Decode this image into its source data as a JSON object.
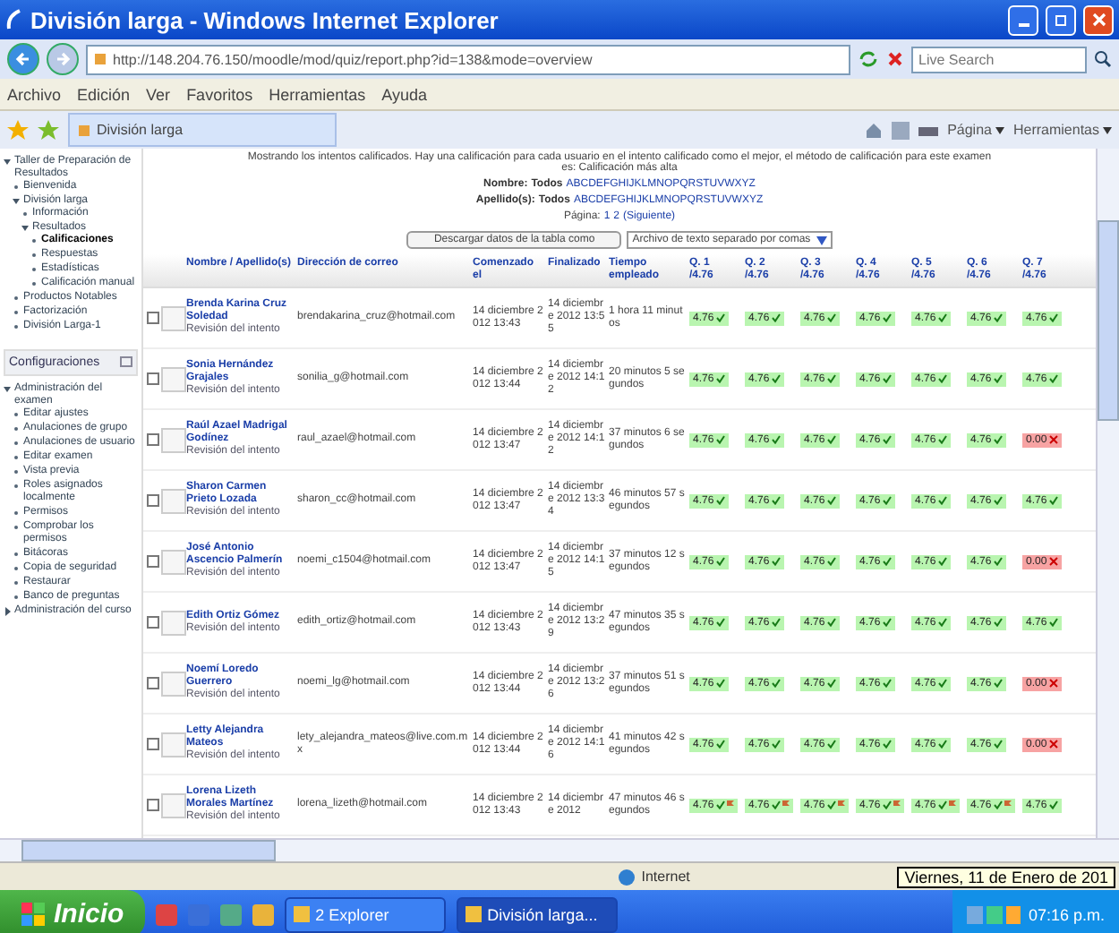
{
  "window": {
    "title": "División larga - Windows Internet Explorer"
  },
  "address": {
    "value": "http://148.204.76.150/moodle/mod/quiz/report.php?id=138&mode=overview"
  },
  "search": {
    "placeholder": "Live Search"
  },
  "menu": [
    "Archivo",
    "Edición",
    "Ver",
    "Favoritos",
    "Herramientas",
    "Ayuda"
  ],
  "tab": {
    "label": "División larga"
  },
  "command_bar": [
    "Página",
    "Herramientas"
  ],
  "sidebar": {
    "items": [
      {
        "label": "Taller de Preparación de Resultados",
        "expanded": true,
        "children": [
          {
            "label": "Bienvenida"
          },
          {
            "label": "División larga",
            "expanded": true,
            "children": [
              {
                "label": "Información"
              },
              {
                "label": "Resultados",
                "expanded": true,
                "children": [
                  {
                    "label": "Calificaciones",
                    "selected": true
                  },
                  {
                    "label": "Respuestas",
                    "selected": false
                  },
                  {
                    "label": "Estadísticas",
                    "selected": false
                  },
                  {
                    "label": "Calificación manual",
                    "selected": false
                  }
                ]
              }
            ]
          },
          {
            "label": "Productos Notables"
          },
          {
            "label": "Factorización"
          },
          {
            "label": "División Larga-1"
          }
        ]
      }
    ],
    "settings_title": "Configuraciones",
    "settings": [
      {
        "label": "Administración del examen",
        "expanded": true,
        "children": [
          {
            "label": "Editar ajustes"
          },
          {
            "label": "Anulaciones de grupo"
          },
          {
            "label": "Anulaciones de usuario"
          },
          {
            "label": "Editar examen"
          },
          {
            "label": "Vista previa"
          },
          {
            "label": "Roles asignados localmente"
          },
          {
            "label": "Permisos"
          },
          {
            "label": "Comprobar los permisos"
          },
          {
            "label": "Bitácoras"
          },
          {
            "label": "Copia de seguridad"
          },
          {
            "label": "Restaurar"
          },
          {
            "label": "Banco de preguntas"
          }
        ]
      },
      {
        "label": "Administración del curso",
        "expanded": false
      }
    ]
  },
  "intro": "Mostrando los intentos calificados. Hay una calificación para cada usuario en el intento calificado como el mejor, el método de calificación para este examen es: Calificación más alta",
  "filters": [
    {
      "label": "Nombre:",
      "all": "Todos",
      "letters": "ABCDEFGHIJKLMNOPQRSTUVWXYZ"
    },
    {
      "label": "Apellido(s):",
      "all": "Todos",
      "letters": "ABCDEFGHIJKLMNOPQRSTUVWXYZ"
    }
  ],
  "paging": {
    "label": "Página:",
    "pages": [
      "1",
      "2"
    ],
    "next": "(Siguiente)"
  },
  "download": {
    "button": "Descargar datos de la tabla como",
    "format": "Archivo de texto separado por comas"
  },
  "table": {
    "columns": [
      "Nombre / Apellido(s)",
      "Dirección de correo",
      "Comenzado el",
      "Finalizado",
      "Tiempo empleado"
    ],
    "questions": [
      {
        "label": "Q. 1",
        "max": "/4.76"
      },
      {
        "label": "Q. 2",
        "max": "/4.76"
      },
      {
        "label": "Q. 3",
        "max": "/4.76"
      },
      {
        "label": "Q. 4",
        "max": "/4.76"
      },
      {
        "label": "Q. 5",
        "max": "/4.76"
      },
      {
        "label": "Q. 6",
        "max": "/4.76"
      },
      {
        "label": "Q. 7",
        "max": "/4.76"
      }
    ],
    "rows": [
      {
        "checked": false,
        "name": "Brenda Karina Cruz Soledad",
        "review": "Revisión del intento",
        "email": "brendakarina_cruz@hotmail.com",
        "started": "14 diciembre 2012 13:43",
        "finished": "14 diciembre 2012 13:55",
        "time": "1 hora 11 minutos",
        "grades": [
          {
            "value": "4.76",
            "correct": true,
            "flagged": false
          },
          {
            "value": "4.76",
            "correct": true,
            "flagged": false
          },
          {
            "value": "4.76",
            "correct": true,
            "flagged": false
          },
          {
            "value": "4.76",
            "correct": true,
            "flagged": false
          },
          {
            "value": "4.76",
            "correct": true,
            "flagged": false
          },
          {
            "value": "4.76",
            "correct": true,
            "flagged": false
          },
          {
            "value": "4.76",
            "correct": true,
            "flagged": false
          }
        ]
      },
      {
        "checked": false,
        "name": "Sonia Hernández Grajales",
        "review": "Revisión del intento",
        "email": "sonilia_g@hotmail.com",
        "started": "14 diciembre 2012 13:44",
        "finished": "14 diciembre 2012 14:12",
        "time": "20 minutos 5 segundos",
        "grades": [
          {
            "value": "4.76",
            "correct": true,
            "flagged": false
          },
          {
            "value": "4.76",
            "correct": true,
            "flagged": false
          },
          {
            "value": "4.76",
            "correct": true,
            "flagged": false
          },
          {
            "value": "4.76",
            "correct": true,
            "flagged": false
          },
          {
            "value": "4.76",
            "correct": true,
            "flagged": false
          },
          {
            "value": "4.76",
            "correct": true,
            "flagged": false
          },
          {
            "value": "4.76",
            "correct": true,
            "flagged": false
          }
        ]
      },
      {
        "checked": false,
        "name": "Raúl Azael Madrigal Godínez",
        "review": "Revisión del intento",
        "email": "raul_azael@hotmail.com",
        "started": "14 diciembre 2012 13:47",
        "finished": "14 diciembre 2012 14:12",
        "time": "37 minutos 6 segundos",
        "grades": [
          {
            "value": "4.76",
            "correct": true,
            "flagged": false
          },
          {
            "value": "4.76",
            "correct": true,
            "flagged": false
          },
          {
            "value": "4.76",
            "correct": true,
            "flagged": false
          },
          {
            "value": "4.76",
            "correct": true,
            "flagged": false
          },
          {
            "value": "4.76",
            "correct": true,
            "flagged": false
          },
          {
            "value": "4.76",
            "correct": true,
            "flagged": false
          },
          {
            "value": "0.00",
            "correct": false,
            "flagged": false
          }
        ]
      },
      {
        "checked": false,
        "name": "Sharon Carmen Prieto Lozada",
        "review": "Revisión del intento",
        "email": "sharon_cc@hotmail.com",
        "started": "14 diciembre 2012 13:47",
        "finished": "14 diciembre 2012 13:34",
        "time": "46 minutos 57 segundos",
        "grades": [
          {
            "value": "4.76",
            "correct": true,
            "flagged": false
          },
          {
            "value": "4.76",
            "correct": true,
            "flagged": false
          },
          {
            "value": "4.76",
            "correct": true,
            "flagged": false
          },
          {
            "value": "4.76",
            "correct": true,
            "flagged": false
          },
          {
            "value": "4.76",
            "correct": true,
            "flagged": false
          },
          {
            "value": "4.76",
            "correct": true,
            "flagged": false
          },
          {
            "value": "4.76",
            "correct": true,
            "flagged": false
          }
        ]
      },
      {
        "checked": false,
        "name": "José Antonio Ascencio Palmerín",
        "review": "Revisión del intento",
        "email": "noemi_c1504@hotmail.com",
        "started": "14 diciembre 2012 13:47",
        "finished": "14 diciembre 2012 14:15",
        "time": "37 minutos 12 segundos",
        "grades": [
          {
            "value": "4.76",
            "correct": true,
            "flagged": false
          },
          {
            "value": "4.76",
            "correct": true,
            "flagged": false
          },
          {
            "value": "4.76",
            "correct": true,
            "flagged": false
          },
          {
            "value": "4.76",
            "correct": true,
            "flagged": false
          },
          {
            "value": "4.76",
            "correct": true,
            "flagged": false
          },
          {
            "value": "4.76",
            "correct": true,
            "flagged": false
          },
          {
            "value": "0.00",
            "correct": false,
            "flagged": false
          }
        ]
      },
      {
        "checked": false,
        "name": "Edith Ortiz Gómez",
        "review": "Revisión del intento",
        "email": "edith_ortiz@hotmail.com",
        "started": "14 diciembre 2012 13:43",
        "finished": "14 diciembre 2012 13:29",
        "time": "47 minutos 35 segundos",
        "grades": [
          {
            "value": "4.76",
            "correct": true,
            "flagged": false
          },
          {
            "value": "4.76",
            "correct": true,
            "flagged": false
          },
          {
            "value": "4.76",
            "correct": true,
            "flagged": false
          },
          {
            "value": "4.76",
            "correct": true,
            "flagged": false
          },
          {
            "value": "4.76",
            "correct": true,
            "flagged": false
          },
          {
            "value": "4.76",
            "correct": true,
            "flagged": false
          },
          {
            "value": "4.76",
            "correct": true,
            "flagged": false
          }
        ]
      },
      {
        "checked": false,
        "name": "Noemí Loredo Guerrero",
        "review": "Revisión del intento",
        "email": "noemi_lg@hotmail.com",
        "started": "14 diciembre 2012 13:44",
        "finished": "14 diciembre 2012 13:26",
        "time": "37 minutos 51 segundos",
        "grades": [
          {
            "value": "4.76",
            "correct": true,
            "flagged": false
          },
          {
            "value": "4.76",
            "correct": true,
            "flagged": false
          },
          {
            "value": "4.76",
            "correct": true,
            "flagged": false
          },
          {
            "value": "4.76",
            "correct": true,
            "flagged": false
          },
          {
            "value": "4.76",
            "correct": true,
            "flagged": false
          },
          {
            "value": "4.76",
            "correct": true,
            "flagged": false
          },
          {
            "value": "0.00",
            "correct": false,
            "flagged": false
          }
        ]
      },
      {
        "checked": false,
        "name": "Letty Alejandra Mateos",
        "review": "Revisión del intento",
        "email": "lety_alejandra_mateos@live.com.mx",
        "started": "14 diciembre 2012 13:44",
        "finished": "14 diciembre 2012 14:16",
        "time": "41 minutos 42 segundos",
        "grades": [
          {
            "value": "4.76",
            "correct": true,
            "flagged": false
          },
          {
            "value": "4.76",
            "correct": true,
            "flagged": false
          },
          {
            "value": "4.76",
            "correct": true,
            "flagged": false
          },
          {
            "value": "4.76",
            "correct": true,
            "flagged": false
          },
          {
            "value": "4.76",
            "correct": true,
            "flagged": false
          },
          {
            "value": "4.76",
            "correct": true,
            "flagged": false
          },
          {
            "value": "0.00",
            "correct": false,
            "flagged": false
          }
        ]
      },
      {
        "checked": false,
        "name": "Lorena Lizeth Morales Martínez",
        "review": "Revisión del intento",
        "email": "lorena_lizeth@hotmail.com",
        "started": "14 diciembre 2012 13:43",
        "finished": "14 diciembre 2012",
        "time": "47 minutos 46 segundos",
        "grades": [
          {
            "value": "4.76",
            "correct": true,
            "flagged": true
          },
          {
            "value": "4.76",
            "correct": true,
            "flagged": true
          },
          {
            "value": "4.76",
            "correct": true,
            "flagged": true
          },
          {
            "value": "4.76",
            "correct": true,
            "flagged": true
          },
          {
            "value": "4.76",
            "correct": true,
            "flagged": true
          },
          {
            "value": "4.76",
            "correct": true,
            "flagged": true
          },
          {
            "value": "4.76",
            "correct": true,
            "flagged": false
          }
        ]
      }
    ]
  },
  "status_bar": {
    "zone": "Internet",
    "tooltip": "Viernes, 11 de Enero de 201"
  },
  "taskbar": {
    "start": "Inicio",
    "tasks": [
      {
        "label": "2 Explorer",
        "selected": false
      },
      {
        "label": "División larga...",
        "selected": true
      }
    ],
    "clock": "07:16 p.m."
  }
}
